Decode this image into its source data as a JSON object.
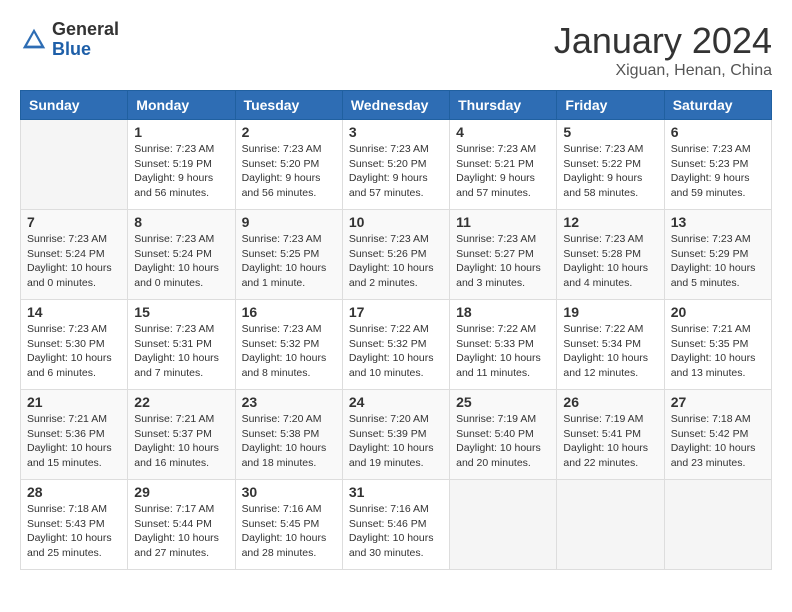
{
  "logo": {
    "general": "General",
    "blue": "Blue"
  },
  "header": {
    "month": "January 2024",
    "location": "Xiguan, Henan, China"
  },
  "weekdays": [
    "Sunday",
    "Monday",
    "Tuesday",
    "Wednesday",
    "Thursday",
    "Friday",
    "Saturday"
  ],
  "weeks": [
    [
      {
        "day": null
      },
      {
        "day": "1",
        "sunrise": "7:23 AM",
        "sunset": "5:19 PM",
        "daylight": "9 hours and 56 minutes."
      },
      {
        "day": "2",
        "sunrise": "7:23 AM",
        "sunset": "5:20 PM",
        "daylight": "9 hours and 56 minutes."
      },
      {
        "day": "3",
        "sunrise": "7:23 AM",
        "sunset": "5:20 PM",
        "daylight": "9 hours and 57 minutes."
      },
      {
        "day": "4",
        "sunrise": "7:23 AM",
        "sunset": "5:21 PM",
        "daylight": "9 hours and 57 minutes."
      },
      {
        "day": "5",
        "sunrise": "7:23 AM",
        "sunset": "5:22 PM",
        "daylight": "9 hours and 58 minutes."
      },
      {
        "day": "6",
        "sunrise": "7:23 AM",
        "sunset": "5:23 PM",
        "daylight": "9 hours and 59 minutes."
      }
    ],
    [
      {
        "day": "7",
        "sunrise": "7:23 AM",
        "sunset": "5:24 PM",
        "daylight": "10 hours and 0 minutes."
      },
      {
        "day": "8",
        "sunrise": "7:23 AM",
        "sunset": "5:24 PM",
        "daylight": "10 hours and 0 minutes."
      },
      {
        "day": "9",
        "sunrise": "7:23 AM",
        "sunset": "5:25 PM",
        "daylight": "10 hours and 1 minute."
      },
      {
        "day": "10",
        "sunrise": "7:23 AM",
        "sunset": "5:26 PM",
        "daylight": "10 hours and 2 minutes."
      },
      {
        "day": "11",
        "sunrise": "7:23 AM",
        "sunset": "5:27 PM",
        "daylight": "10 hours and 3 minutes."
      },
      {
        "day": "12",
        "sunrise": "7:23 AM",
        "sunset": "5:28 PM",
        "daylight": "10 hours and 4 minutes."
      },
      {
        "day": "13",
        "sunrise": "7:23 AM",
        "sunset": "5:29 PM",
        "daylight": "10 hours and 5 minutes."
      }
    ],
    [
      {
        "day": "14",
        "sunrise": "7:23 AM",
        "sunset": "5:30 PM",
        "daylight": "10 hours and 6 minutes."
      },
      {
        "day": "15",
        "sunrise": "7:23 AM",
        "sunset": "5:31 PM",
        "daylight": "10 hours and 7 minutes."
      },
      {
        "day": "16",
        "sunrise": "7:23 AM",
        "sunset": "5:32 PM",
        "daylight": "10 hours and 8 minutes."
      },
      {
        "day": "17",
        "sunrise": "7:22 AM",
        "sunset": "5:32 PM",
        "daylight": "10 hours and 10 minutes."
      },
      {
        "day": "18",
        "sunrise": "7:22 AM",
        "sunset": "5:33 PM",
        "daylight": "10 hours and 11 minutes."
      },
      {
        "day": "19",
        "sunrise": "7:22 AM",
        "sunset": "5:34 PM",
        "daylight": "10 hours and 12 minutes."
      },
      {
        "day": "20",
        "sunrise": "7:21 AM",
        "sunset": "5:35 PM",
        "daylight": "10 hours and 13 minutes."
      }
    ],
    [
      {
        "day": "21",
        "sunrise": "7:21 AM",
        "sunset": "5:36 PM",
        "daylight": "10 hours and 15 minutes."
      },
      {
        "day": "22",
        "sunrise": "7:21 AM",
        "sunset": "5:37 PM",
        "daylight": "10 hours and 16 minutes."
      },
      {
        "day": "23",
        "sunrise": "7:20 AM",
        "sunset": "5:38 PM",
        "daylight": "10 hours and 18 minutes."
      },
      {
        "day": "24",
        "sunrise": "7:20 AM",
        "sunset": "5:39 PM",
        "daylight": "10 hours and 19 minutes."
      },
      {
        "day": "25",
        "sunrise": "7:19 AM",
        "sunset": "5:40 PM",
        "daylight": "10 hours and 20 minutes."
      },
      {
        "day": "26",
        "sunrise": "7:19 AM",
        "sunset": "5:41 PM",
        "daylight": "10 hours and 22 minutes."
      },
      {
        "day": "27",
        "sunrise": "7:18 AM",
        "sunset": "5:42 PM",
        "daylight": "10 hours and 23 minutes."
      }
    ],
    [
      {
        "day": "28",
        "sunrise": "7:18 AM",
        "sunset": "5:43 PM",
        "daylight": "10 hours and 25 minutes."
      },
      {
        "day": "29",
        "sunrise": "7:17 AM",
        "sunset": "5:44 PM",
        "daylight": "10 hours and 27 minutes."
      },
      {
        "day": "30",
        "sunrise": "7:16 AM",
        "sunset": "5:45 PM",
        "daylight": "10 hours and 28 minutes."
      },
      {
        "day": "31",
        "sunrise": "7:16 AM",
        "sunset": "5:46 PM",
        "daylight": "10 hours and 30 minutes."
      },
      {
        "day": null
      },
      {
        "day": null
      },
      {
        "day": null
      }
    ]
  ]
}
